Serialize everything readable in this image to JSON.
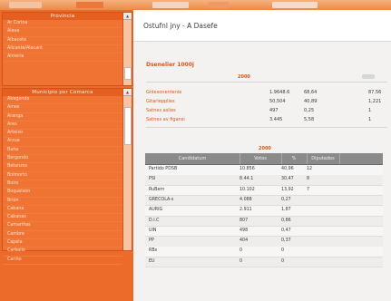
{
  "page_title": "Ostufnl jny - A Dasefe",
  "section_title": "Dsenelier 1000j",
  "year_label": "2000",
  "summary_rows": [
    {
      "label": "Gnlexonentenie",
      "v1": "1.9648.6",
      "v2": "68,64",
      "v3": "87,56"
    },
    {
      "label": "Gitariepplies",
      "v1": "50,504",
      "v2": "40,89",
      "v3": "1,221"
    },
    {
      "label": "Satnes aslies",
      "v1": "497",
      "v2": "0,25",
      "v3": "1"
    },
    {
      "label": "Satnes av figansi",
      "v1": "3.445",
      "v2": "5,58",
      "v3": "1"
    }
  ],
  "mid_label": "2000",
  "table": {
    "headers": [
      "Candidatum",
      "Votos",
      "%",
      "Diputados"
    ],
    "rows": [
      {
        "c0": "Partido PDSB",
        "c1": "10.856",
        "c2": "40,96",
        "c3": "12"
      },
      {
        "c0": "PSI",
        "c1": "8.44.1",
        "c2": "30,47",
        "c3": "8"
      },
      {
        "c0": "RuBern",
        "c1": "10.102",
        "c2": "13,92",
        "c3": "7"
      },
      {
        "c0": "GRECOLA-s",
        "c1": "4.088",
        "c2": "0,27",
        "c3": ""
      },
      {
        "c0": "AURIG",
        "c1": "2.911",
        "c2": "1,87",
        "c3": ""
      },
      {
        "c0": "D.I.C",
        "c1": "807",
        "c2": "0,86",
        "c3": ""
      },
      {
        "c0": "UIN",
        "c1": "498",
        "c2": "0,47",
        "c3": ""
      },
      {
        "c0": "PP",
        "c1": "404",
        "c2": "0,37",
        "c3": ""
      },
      {
        "c0": "RBs",
        "c1": "0",
        "c2": "0",
        "c3": ""
      },
      {
        "c0": "EU",
        "c1": "0",
        "c2": "0",
        "c3": ""
      }
    ]
  },
  "sidebar": {
    "panel1_title": "Provincia",
    "panel1_items": [
      "Ar Corina",
      "Alava",
      "Albacete",
      "Alicante/Alacant",
      "Almeria"
    ],
    "panel2_title": "Municipio por Comarca",
    "panel2_items": [
      "Abegondo",
      "Ames",
      "Aranga",
      "Ares",
      "Arteixo",
      "Arzua",
      "Baña",
      "Bergondo",
      "Betanzos",
      "Boimorto",
      "Boiro",
      "Boqueixón",
      "Brión",
      "Cabana",
      "Cabanas",
      "Camariñas",
      "Cambre",
      "Capela",
      "Carballo",
      "Cariño"
    ]
  },
  "colors": {
    "sidebar_bg": "#ec6a2a",
    "accent": "#d2581e",
    "table_header": "#8a8a8a"
  }
}
